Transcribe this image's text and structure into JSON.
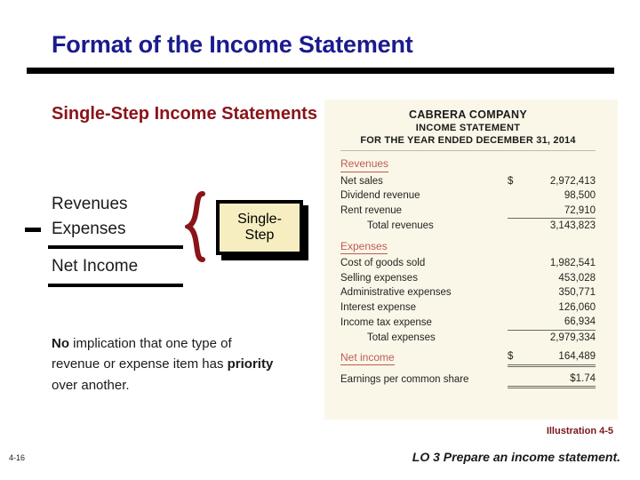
{
  "slide": {
    "title": "Format of the Income Statement",
    "slide_number": "4-16",
    "learning_objective": "LO 3  Prepare an income statement.",
    "title_color": "#1b1b8f",
    "heading_color": "#8a1419"
  },
  "left": {
    "heading": "Single-Step Income Statements",
    "equation": {
      "minus_symbol": "–",
      "term_1": "Revenues",
      "term_2": "Expenses",
      "result": "Net Income"
    },
    "callout": {
      "line_1": "Single-",
      "line_2": "Step",
      "fill_color": "#f6eec0"
    },
    "body_parts": {
      "bold_1": "No",
      "text_1": " implication that one type of revenue or expense item has ",
      "bold_2": "priority",
      "text_2": " over another."
    }
  },
  "illustration": {
    "caption": "Illustration 4-5",
    "panel_color": "#faf7e9",
    "header": {
      "company": "CABRERA COMPANY",
      "statement": "INCOME STATEMENT",
      "period": "FOR THE YEAR ENDED DECEMBER 31, 2014"
    },
    "revenues": {
      "label": "Revenues",
      "rows": [
        {
          "label": "Net sales",
          "currency": "$",
          "amount": "2,972,413"
        },
        {
          "label": "Dividend revenue",
          "currency": "",
          "amount": "98,500"
        },
        {
          "label": "Rent revenue",
          "currency": "",
          "amount": "72,910"
        }
      ],
      "total": {
        "label": "Total revenues",
        "currency": "",
        "amount": "3,143,823"
      }
    },
    "expenses": {
      "label": "Expenses",
      "rows": [
        {
          "label": "Cost of goods sold",
          "currency": "",
          "amount": "1,982,541"
        },
        {
          "label": "Selling expenses",
          "currency": "",
          "amount": "453,028"
        },
        {
          "label": "Administrative expenses",
          "currency": "",
          "amount": "350,771"
        },
        {
          "label": "Interest expense",
          "currency": "",
          "amount": "126,060"
        },
        {
          "label": "Income tax expense",
          "currency": "",
          "amount": "66,934"
        }
      ],
      "total": {
        "label": "Total expenses",
        "currency": "",
        "amount": "2,979,334"
      }
    },
    "net_income": {
      "label": "Net income",
      "currency": "$",
      "amount": "164,489"
    },
    "eps": {
      "label": "Earnings per common share",
      "currency": "",
      "amount": "$1.74"
    }
  }
}
